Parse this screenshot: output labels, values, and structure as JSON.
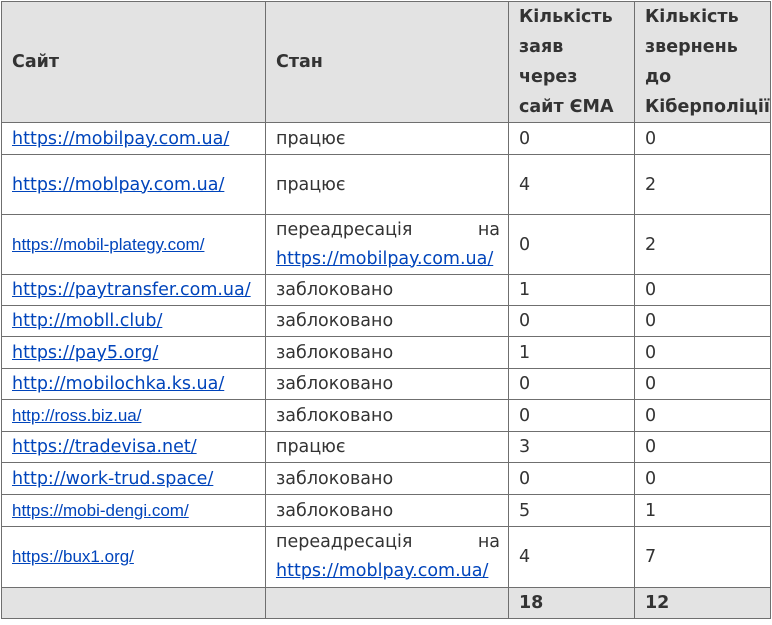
{
  "headers": {
    "site": "Сайт",
    "status": "Стан",
    "ema": "Кількість заяв через сайт ЄМА",
    "cyber": "Кількість звернень до Кіберполіції"
  },
  "rows": [
    {
      "url": "https://mobilpay.com.ua/",
      "status": "працює",
      "ema": "0",
      "cyber": "0"
    },
    {
      "url": "https://moblpay.com.ua/",
      "status": "працює",
      "ema": "4",
      "cyber": "2"
    },
    {
      "url": "https://mobil-plategy.com/",
      "status_pre": "переадресація на",
      "status_link": "https://mobilpay.com.ua/",
      "ema": "0",
      "cyber": "2"
    },
    {
      "url": "https://paytransfer.com.ua/",
      "status": "заблоковано",
      "ema": "1",
      "cyber": "0"
    },
    {
      "url": "http://mobll.club/",
      "status": "заблоковано",
      "ema": "0",
      "cyber": "0"
    },
    {
      "url": "https://pay5.org/",
      "status": "заблоковано",
      "ema": "1",
      "cyber": "0"
    },
    {
      "url": "http://mobilochka.ks.ua/",
      "status": "заблоковано",
      "ema": "0",
      "cyber": "0"
    },
    {
      "url": "http://ross.biz.ua/",
      "status": "заблоковано",
      "ema": "0",
      "cyber": "0"
    },
    {
      "url": "https://tradevisa.net/",
      "status": "працює",
      "ema": "3",
      "cyber": "0"
    },
    {
      "url": "http://work-trud.space/",
      "status": "заблоковано",
      "ema": "0",
      "cyber": "0"
    },
    {
      "url": "https://mobi-dengi.com/",
      "status": "заблоковано",
      "ema": "5",
      "cyber": "1"
    },
    {
      "url": "https://bux1.org/",
      "status_pre": "переадресація на",
      "status_link": "https://moblpay.com.ua/",
      "ema": "4",
      "cyber": "7"
    }
  ],
  "totals": {
    "ema": "18",
    "cyber": "12"
  }
}
